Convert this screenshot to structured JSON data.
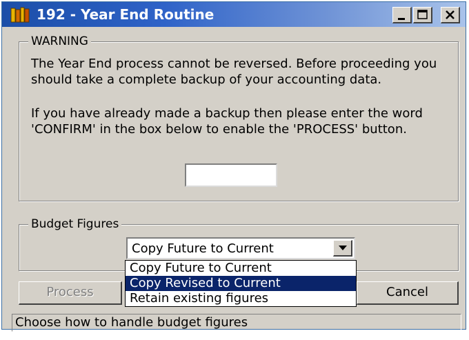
{
  "window": {
    "title": "192 - Year End Routine",
    "titlebar_color": "#1b4ea8",
    "app_icon": "books-icon",
    "controls": [
      "minimize-icon",
      "maximize-icon",
      "close-icon"
    ]
  },
  "warning": {
    "legend": "WARNING",
    "paragraph1": "The Year End process cannot be reversed. Before proceeding you should take a complete backup of your accounting data.",
    "paragraph2": "If you have already made a backup then please enter the word 'CONFIRM' in the box below to enable the 'PROCESS' button.",
    "confirm_value": ""
  },
  "budget": {
    "legend": "Budget Figures",
    "selected": "Copy Future to Current",
    "options": [
      "Copy Future to Current",
      "Copy Revised to Current",
      "Retain existing figures"
    ],
    "highlighted_option": "Copy Revised to Current"
  },
  "buttons": {
    "process": "Process",
    "cancel": "Cancel"
  },
  "status": {
    "text": "Choose how to handle budget figures"
  },
  "colors": {
    "face": "#d4d0c8",
    "selection": "#0a246a"
  }
}
